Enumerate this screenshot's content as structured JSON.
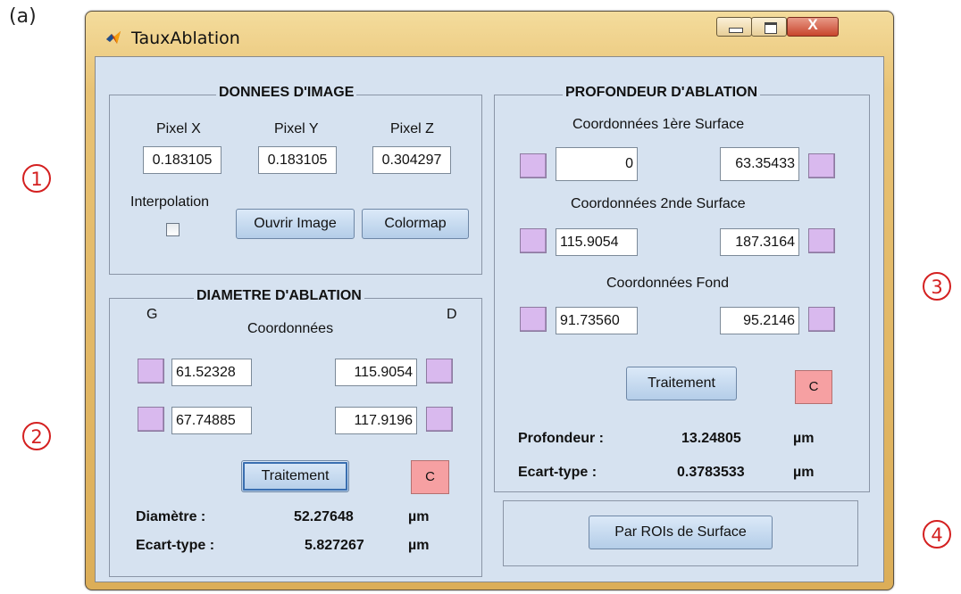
{
  "figure_label": "(a)",
  "markers": [
    "1",
    "2",
    "3",
    "4"
  ],
  "window": {
    "title": "TauxAblation",
    "icon": "matlab-logo-icon",
    "controls": {
      "minimize": "minimize-icon",
      "maximize": "maximize-icon",
      "close_label": "X"
    }
  },
  "image_data": {
    "title": "DONNEES D'IMAGE",
    "pixel_x_label": "Pixel X",
    "pixel_y_label": "Pixel Y",
    "pixel_z_label": "Pixel Z",
    "pixel_x": "0.183105",
    "pixel_y": "0.183105",
    "pixel_z": "0.304297",
    "interpolation_label": "Interpolation",
    "interpolation_checked": false,
    "open_button": "Ouvrir Image",
    "colormap_button": "Colormap"
  },
  "diameter": {
    "title": "DIAMETRE D'ABLATION",
    "left_label": "G",
    "right_label": "D",
    "coords_label": "Coordonnées",
    "g1": "61.52328",
    "d1": "115.9054",
    "g2": "67.74885",
    "d2": "117.9196",
    "process_button": "Traitement",
    "clear_button": "C",
    "diameter_label": "Diamètre :",
    "diameter_value": "52.27648",
    "diameter_unit": "µm",
    "std_label": "Ecart-type :",
    "std_value": "5.827267",
    "std_unit": "µm"
  },
  "depth": {
    "title": "PROFONDEUR D'ABLATION",
    "surface1_label": "Coordonnées 1ère Surface",
    "s1_left": "0",
    "s1_right": "63.35433",
    "surface2_label": "Coordonnées 2nde Surface",
    "s2_left": "115.9054",
    "s2_right": "187.3164",
    "bottom_label": "Coordonnées Fond",
    "f_left": "91.73560",
    "f_right": "95.2146",
    "process_button": "Traitement",
    "clear_button": "C",
    "depth_label": "Profondeur :",
    "depth_value": "13.24805",
    "depth_unit": "µm",
    "std_label": "Ecart-type :",
    "std_value": "0.3783533",
    "std_unit": "µm"
  },
  "roi": {
    "button": "Par ROIs de Surface"
  },
  "colors": {
    "panel_bg": "#d6e2f0",
    "pick_button": "#d9b9ee",
    "clear_button": "#f6a0a2",
    "marker": "#d42020"
  }
}
